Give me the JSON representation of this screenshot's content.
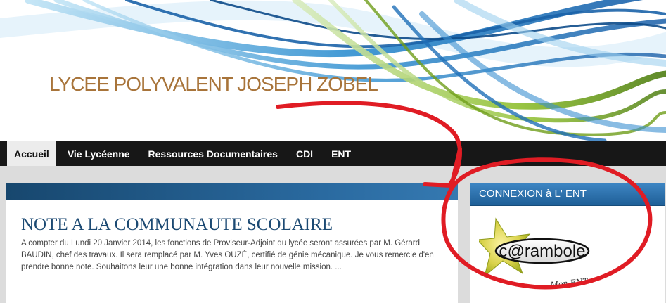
{
  "site": {
    "title": "LYCEE POLYVALENT JOSEPH ZOBEL"
  },
  "nav": {
    "items": [
      {
        "label": "Accueil",
        "active": true
      },
      {
        "label": "Vie Lycéenne"
      },
      {
        "label": "Ressources Documentaires"
      },
      {
        "label": "CDI"
      },
      {
        "label": "ENT"
      }
    ]
  },
  "post": {
    "title": "NOTE A LA COMMUNAUTE SCOLAIRE",
    "body": "A compter du Lundi 20 Janvier 2014, les fonctions de Proviseur-Adjoint du lycée seront assurées par M. Gérard BAUDIN, chef des travaux.   Il sera remplacé par M. Yves OUZÉ, certifié de génie mécanique.   Je vous remercie d'en prendre bonne note.   Souhaitons leur une bonne intégration dans leur nouvelle mission.        ..."
  },
  "sidebar": {
    "widget_title": "CONNEXION à L' ENT",
    "logo_text": "c@rambole",
    "logo_subtitle": "Mon ENT"
  },
  "colors": {
    "title": "#a8743a",
    "nav_bg": "#171717",
    "post_title": "#1c4a73",
    "widget_head": "#2f73b0",
    "annotation": "#e01c24"
  }
}
